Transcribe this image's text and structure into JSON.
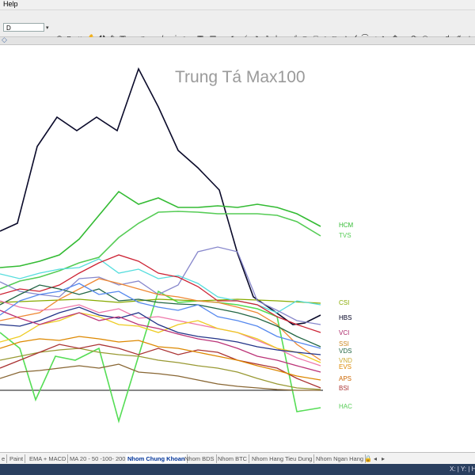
{
  "menu": {
    "help": "Help"
  },
  "toolbar": {
    "period": "D"
  },
  "chart": {
    "title": "Trung Tá Max100",
    "labels": [
      {
        "text": "HCM",
        "color": "#33bb33"
      },
      {
        "text": "TVS",
        "color": "#55cc55"
      },
      {
        "text": "CSI",
        "color": "#88aa00"
      },
      {
        "text": "HBS",
        "color": "#000022"
      },
      {
        "text": "VCI",
        "color": "#aa2266"
      },
      {
        "text": "SSI",
        "color": "#cc8822"
      },
      {
        "text": "VDS",
        "color": "#226644"
      },
      {
        "text": "VND",
        "color": "#ccaa33"
      },
      {
        "text": "EVS",
        "color": "#dd8800"
      },
      {
        "text": "APS",
        "color": "#cc6600"
      },
      {
        "text": "BSI",
        "color": "#aa3333"
      },
      {
        "text": "HAC",
        "color": "#55cc55"
      }
    ]
  },
  "tabs": [
    {
      "label": "e",
      "active": false
    },
    {
      "label": "Paint",
      "active": false
    },
    {
      "label": "EMA + MACD",
      "active": false
    },
    {
      "label": "MA 20 - 50 -100- 200",
      "active": false
    },
    {
      "label": "Nhom Chung Khoan",
      "active": true
    },
    {
      "label": "Nhom BDS",
      "active": false
    },
    {
      "label": "Nhom BTC",
      "active": false
    },
    {
      "label": "Nhom Hang Tieu Dung",
      "active": false
    },
    {
      "label": "Nhom Ngan Hang",
      "active": false
    }
  ],
  "status": {
    "coords": "X: | Y: | H"
  },
  "icons": [
    "help-menu",
    "period-dropdown",
    "drawing-tools",
    "zoom-tools"
  ]
}
